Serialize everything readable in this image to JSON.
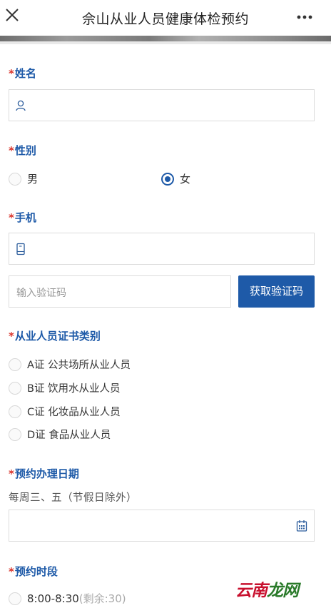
{
  "header": {
    "title": "佘山从业人员健康体检预约",
    "close_icon": "close-icon",
    "more_icon": "more-dots-icon"
  },
  "form": {
    "name": {
      "required": "*",
      "label": "姓名",
      "value": "",
      "icon": "user-icon"
    },
    "gender": {
      "required": "*",
      "label": "性别",
      "options": [
        {
          "label": "男",
          "selected": false
        },
        {
          "label": "女",
          "selected": true
        }
      ]
    },
    "phone": {
      "required": "*",
      "label": "手机",
      "value": "",
      "icon": "phone-icon"
    },
    "verify": {
      "placeholder": "输入验证码",
      "button_label": "获取验证码"
    },
    "cert_type": {
      "required": "*",
      "label": "从业人员证书类别",
      "options": [
        {
          "label": "A证 公共场所从业人员",
          "selected": false
        },
        {
          "label": "B证 饮用水从业人员",
          "selected": false
        },
        {
          "label": "C证 化妆品从业人员",
          "selected": false
        },
        {
          "label": "D证 食品从业人员",
          "selected": false
        }
      ]
    },
    "date": {
      "required": "*",
      "label": "预约办理日期",
      "hint": "每周三、五（节假日除外）",
      "value": "",
      "icon": "calendar-icon"
    },
    "time_slot": {
      "required": "*",
      "label": "预约时段",
      "options": [
        {
          "time": "8:00-8:30",
          "remaining": "(剩余:30)",
          "selected": false
        }
      ]
    }
  },
  "watermark": {
    "part1": "云南",
    "part2": "龙网"
  },
  "colors": {
    "accent": "#1e5aa8",
    "required": "#d9342b"
  }
}
